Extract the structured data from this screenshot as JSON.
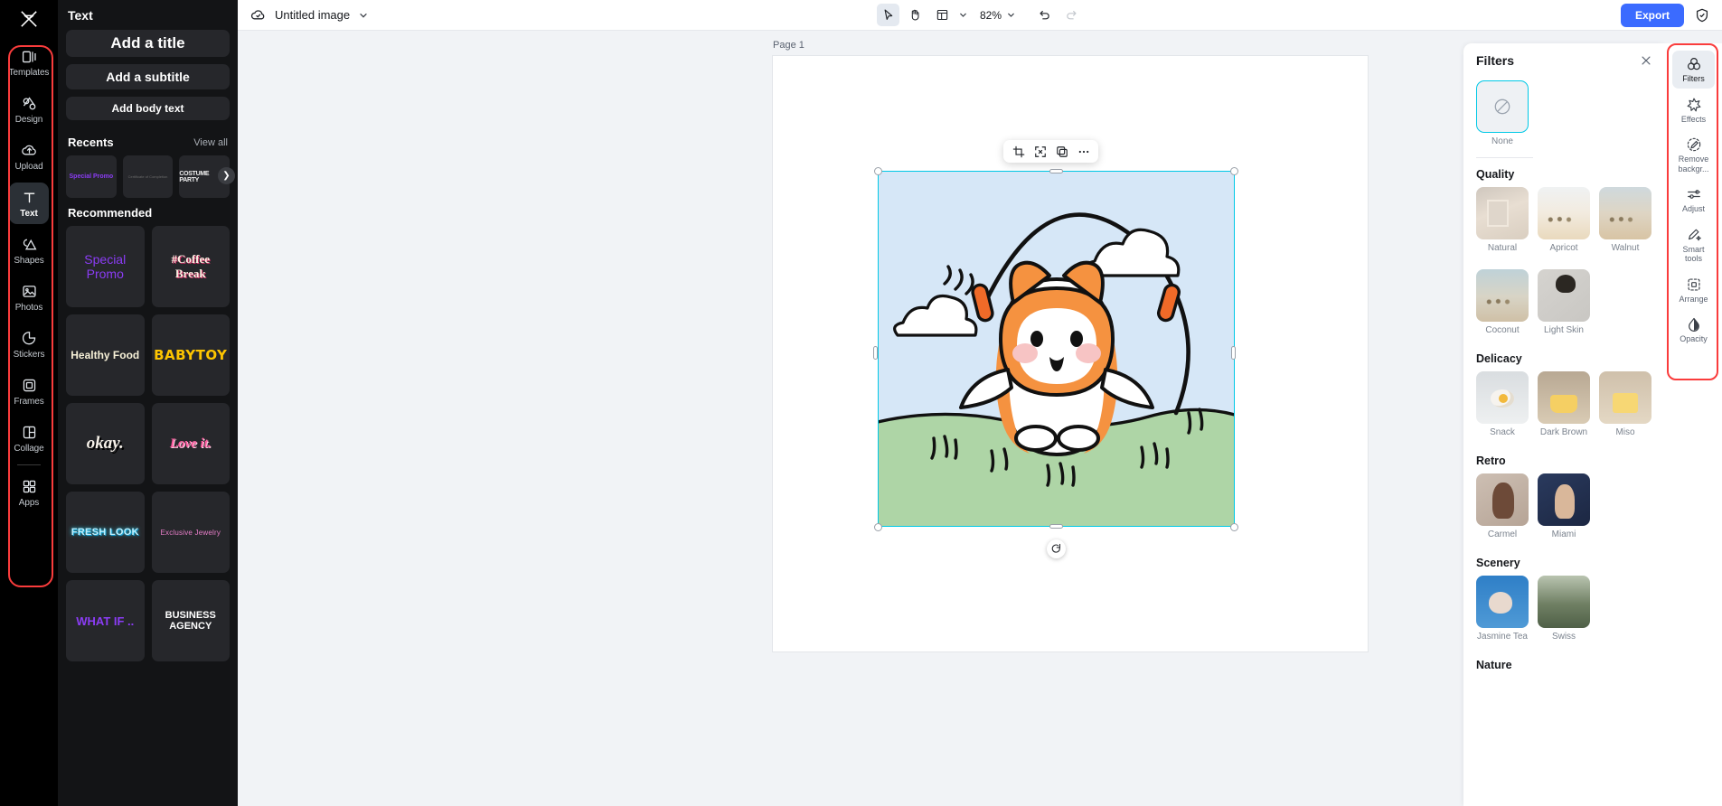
{
  "left_rail": {
    "logo": "capcut-logo-icon",
    "items": [
      {
        "label": "Templates",
        "icon": "templates-icon",
        "active": false
      },
      {
        "label": "Design",
        "icon": "design-icon",
        "active": false
      },
      {
        "label": "Upload",
        "icon": "upload-cloud-icon",
        "active": false
      },
      {
        "label": "Text",
        "icon": "text-icon",
        "active": true
      },
      {
        "label": "Shapes",
        "icon": "shapes-icon",
        "active": false
      },
      {
        "label": "Photos",
        "icon": "photos-icon",
        "active": false
      },
      {
        "label": "Stickers",
        "icon": "stickers-icon",
        "active": false
      },
      {
        "label": "Frames",
        "icon": "frames-icon",
        "active": false
      },
      {
        "label": "Collage",
        "icon": "collage-icon",
        "active": false
      }
    ],
    "apps": {
      "label": "Apps",
      "icon": "apps-grid-icon"
    }
  },
  "text_panel": {
    "title": "Text",
    "buttons": [
      {
        "label": "Add a title"
      },
      {
        "label": "Add a subtitle"
      },
      {
        "label": "Add body text"
      }
    ],
    "recents": {
      "heading": "Recents",
      "view_all": "View all",
      "items": [
        {
          "label": "Special Promo"
        },
        {
          "label": "Certificate of Completion"
        },
        {
          "label": "COSTUME PARTY"
        }
      ],
      "next_arrow": "chevron-right-icon"
    },
    "recommended": {
      "heading": "Recommended",
      "items": [
        {
          "label": "Special Promo"
        },
        {
          "label": "#Coffee Break"
        },
        {
          "label": "Healthy Food"
        },
        {
          "label": "BABYTOY"
        },
        {
          "label": "okay."
        },
        {
          "label": "Love it."
        },
        {
          "label": "FRESH LOOK"
        },
        {
          "label": "Exclusive Jewelry"
        },
        {
          "label": "WHAT IF .."
        },
        {
          "label": "BUSINESS AGENCY"
        }
      ]
    }
  },
  "topbar": {
    "cloud_icon": "cloud-saved-icon",
    "doc_name": "Untitled image",
    "doc_caret": "chevron-down-icon",
    "tools": [
      {
        "name": "select-tool",
        "icon": "cursor-arrow-icon",
        "selected": true
      },
      {
        "name": "hand-tool",
        "icon": "hand-icon",
        "selected": false
      },
      {
        "name": "layout-tool",
        "icon": "layout-panel-icon",
        "selected": false
      }
    ],
    "layout_caret": "chevron-down-icon",
    "zoom": "82%",
    "zoom_caret": "chevron-down-icon",
    "undo": "undo-arrow-icon",
    "redo": "redo-arrow-icon",
    "export_label": "Export",
    "shield_icon": "shield-check-icon"
  },
  "canvas": {
    "page_label": "Page 1",
    "float_toolbar": [
      {
        "name": "crop-button",
        "icon": "crop-icon"
      },
      {
        "name": "resize-button",
        "icon": "expand-icon"
      },
      {
        "name": "duplicate-button",
        "icon": "copy-icon"
      },
      {
        "name": "more-button",
        "icon": "ellipsis-icon"
      }
    ],
    "rotate_handle": "rotate-icon"
  },
  "filters_panel": {
    "title": "Filters",
    "close_icon": "close-icon",
    "none": {
      "label": "None",
      "icon": "no-filter-icon",
      "selected": true
    },
    "groups": [
      {
        "title": "Quality",
        "items": [
          "Natural",
          "Apricot",
          "Walnut",
          "Coconut",
          "Light Skin"
        ]
      },
      {
        "title": "Delicacy",
        "items": [
          "Snack",
          "Dark Brown",
          "Miso"
        ]
      },
      {
        "title": "Retro",
        "items": [
          "Carmel",
          "Miami"
        ]
      },
      {
        "title": "Scenery",
        "items": [
          "Jasmine Tea",
          "Swiss"
        ]
      },
      {
        "title": "Nature",
        "items": []
      }
    ]
  },
  "right_rail": {
    "items": [
      {
        "label": "Filters",
        "icon": "filters-icon",
        "active": true
      },
      {
        "label": "Effects",
        "icon": "effects-star-icon",
        "active": false
      },
      {
        "label": "Remove\nbackgr...",
        "icon": "remove-bg-icon",
        "active": false
      },
      {
        "label": "Adjust",
        "icon": "adjust-sliders-icon",
        "active": false
      },
      {
        "label": "Smart\ntools",
        "icon": "smart-tools-icon",
        "active": false
      },
      {
        "label": "Arrange",
        "icon": "arrange-icon",
        "active": false
      },
      {
        "label": "Opacity",
        "icon": "opacity-drop-icon",
        "active": false
      }
    ]
  },
  "colors": {
    "accent": "#3b6bff",
    "selection": "#00c8e6",
    "highlight_box": "#fa3c3c",
    "rail_bg": "#000000",
    "panel_bg": "#131416"
  }
}
